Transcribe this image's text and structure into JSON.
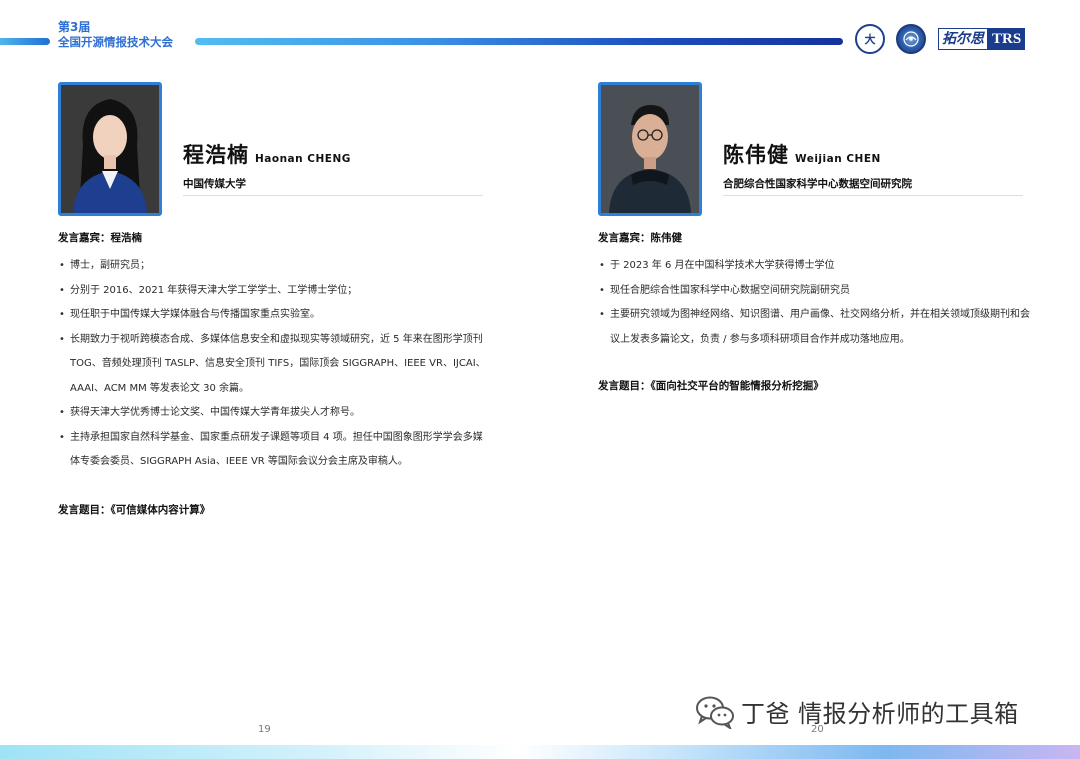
{
  "header": {
    "conference_line1": "第3届",
    "conference_line2": "全国开源情报技术大会",
    "logo1_text": "大",
    "logo2_text": "",
    "logo3_cn": "拓尔思",
    "logo3_en": "TRS"
  },
  "speakers": [
    {
      "name_cn": "程浩楠",
      "name_en": "Haonan CHENG",
      "affiliation": "中国传媒大学",
      "guest_label": "发言嘉宾：程浩楠",
      "bullets": [
        "博士，副研究员；",
        "分别于 2016、2021 年获得天津大学工学学士、工学博士学位；",
        "现任职于中国传媒大学媒体融合与传播国家重点实验室。",
        "长期致力于视听跨模态合成、多媒体信息安全和虚拟现实等领域研究，近 5 年来在图形学顶刊 TOG、音频处理顶刊 TASLP、信息安全顶刊 TIFS，国际顶会 SIGGRAPH、IEEE VR、IJCAI、AAAI、ACM MM 等发表论文 30 余篇。",
        "获得天津大学优秀博士论文奖、中国传媒大学青年拔尖人才称号。",
        "主持承担国家自然科学基金、国家重点研发子课题等项目 4 项。担任中国图象图形学学会多媒体专委会委员、SIGGRAPH Asia、IEEE VR 等国际会议分会主席及审稿人。"
      ],
      "topic": "发言题目：《可信媒体内容计算》",
      "page": "19"
    },
    {
      "name_cn": "陈伟健",
      "name_en": "Weijian CHEN",
      "affiliation": "合肥综合性国家科学中心数据空间研究院",
      "guest_label": "发言嘉宾：陈伟健",
      "bullets": [
        "于 2023 年 6 月在中国科学技术大学获得博士学位",
        "现任合肥综合性国家科学中心数据空间研究院副研究员",
        "主要研究领域为图神经网络、知识图谱、用户画像、社交网络分析，并在相关领域顶级期刊和会议上发表多篇论文，负责 / 参与多项科研项目合作并成功落地应用。"
      ],
      "topic": "发言题目：《面向社交平台的智能情报分析挖掘》",
      "page": "20"
    }
  ],
  "watermark": {
    "text": "丁爸 情报分析师的工具箱",
    "icon": "wechat-icon"
  },
  "colors": {
    "accent_blue": "#2e7fd8",
    "title_blue": "#2f6fd1",
    "dark_navy": "#1a3c8c"
  }
}
